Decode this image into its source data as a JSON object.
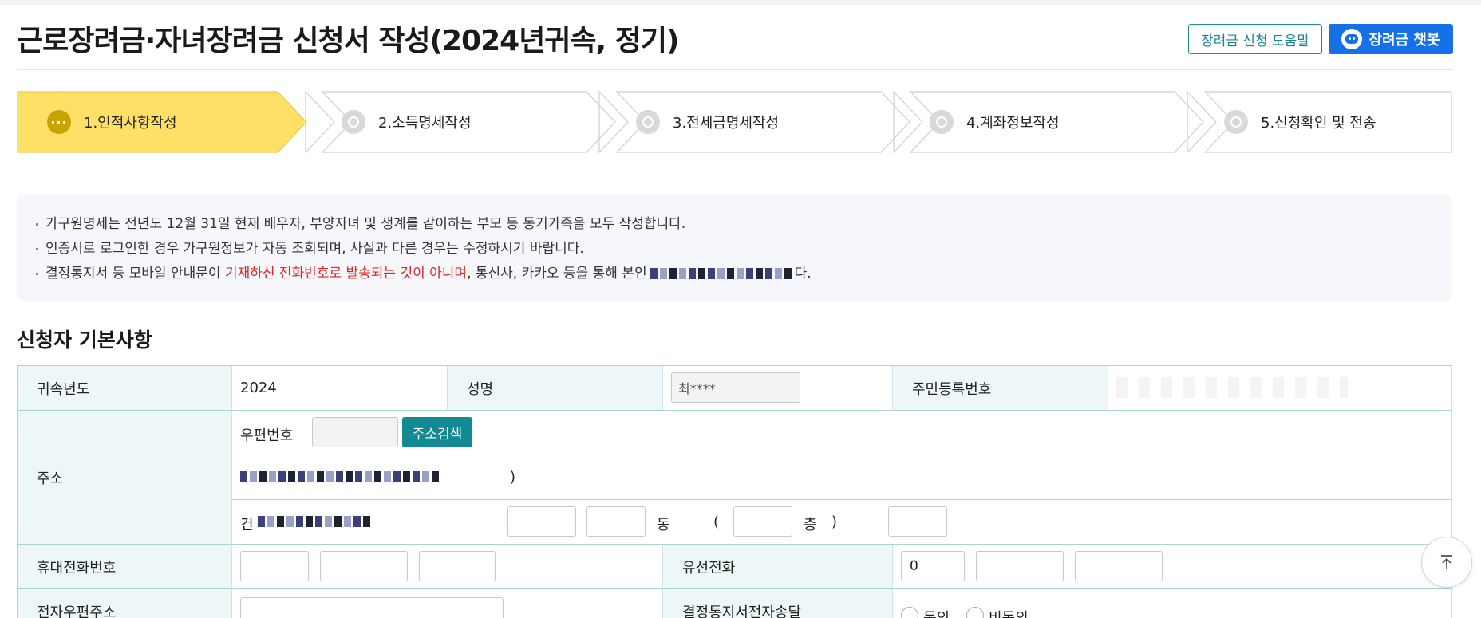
{
  "page": {
    "title": "근로장려금·자녀장려금 신청서 작성(2024년귀속, 정기)",
    "help_button": "장려금 신청 도움말",
    "chatbot_button": "장려금 챗봇"
  },
  "steps": [
    {
      "label": "1.인적사항작성",
      "state": "active",
      "icon": "more-dots-icon"
    },
    {
      "label": "2.소득명세작성",
      "state": "inactive",
      "icon": "circle-icon"
    },
    {
      "label": "3.전세금명세작성",
      "state": "inactive",
      "icon": "circle-icon"
    },
    {
      "label": "4.계좌정보작성",
      "state": "inactive",
      "icon": "circle-icon"
    },
    {
      "label": "5.신청확인 및 전송",
      "state": "inactive",
      "icon": "circle-icon"
    }
  ],
  "notice": {
    "line1": "가구원명세는 전년도 12월 31일 현재 배우자, 부양자녀 및 생계를 같이하는 부모 등 동거가족을 모두 작성합니다.",
    "line2": "인증서로 로그인한 경우 가구원정보가 자동 조회되며, 사실과 다른 경우는 수정하시기 바랍니다.",
    "line3_before": "결정통지서 등 모바일 안내문이 ",
    "line3_red": "기재하신 전화번호로 발송되는 것이 아니며",
    "line3_after": ", 통신사, 카카오 등을 통해 본인",
    "line3_end": "다."
  },
  "section": {
    "title": "신청자 기본사항"
  },
  "form": {
    "year_label": "귀속년도",
    "year_value": "2024",
    "name_label": "성명",
    "name_value": "최****",
    "rrn_label": "주민등록번호",
    "address_label": "주소",
    "postal_label": "우편번호",
    "address_search_button": "주소검색",
    "address_line2_suffix": ")",
    "address_line3_prefix": "건",
    "dong_label": "동",
    "open_paren": "(",
    "floor_label": "층",
    "close_paren": ")",
    "mobile_label": "휴대전화번호",
    "landline_label": "유선전화",
    "landline_prefix": "0",
    "email_label": "전자우편주소",
    "notice_delivery_label": "결정통지서전자송달",
    "agree_label": "동의",
    "disagree_label": "비동의"
  },
  "colors": {
    "active_step": "#ffe066",
    "accent_teal": "#118a93",
    "chatbot_blue": "#1771e6",
    "warning_red": "#e02424"
  },
  "icons": {
    "scroll_top": "arrow-up-icon",
    "chatbot": "chatbot-icon"
  }
}
